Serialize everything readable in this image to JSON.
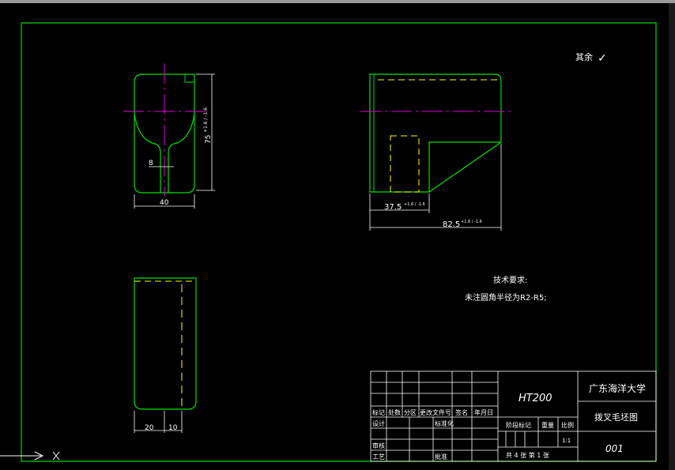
{
  "roughness": {
    "label": "其余",
    "symbol": "✓"
  },
  "front_view": {
    "dim_width": "40",
    "dim_slot": "8",
    "dim_height": "75",
    "dim_height_tol": "+1.6 / -1.6"
  },
  "side_view": {
    "dim_inner": "37.5",
    "dim_inner_tol": "+1.6 / -1.6",
    "dim_overall": "82.5",
    "dim_overall_tol": "+1.6 / -1.6"
  },
  "top_view": {
    "dim_a": "20",
    "dim_b": "10"
  },
  "notes": {
    "title": "技术要求:",
    "line1": "未注圆角半径为R2-R5;"
  },
  "title_block": {
    "material": "HT200",
    "university": "广东海洋大学",
    "drawing_name": "拨叉毛坯图",
    "drawing_no": "001",
    "hdr_mark": "标记",
    "hdr_count": "处数",
    "hdr_zone": "分区",
    "hdr_change_doc": "更改文件号",
    "hdr_sign": "签名",
    "hdr_date": "年月日",
    "design": "设计",
    "standardize": "标准化",
    "review": "审核",
    "process": "工艺",
    "approve": "批准",
    "stage_mark": "阶段标记",
    "weight": "重量",
    "scale": "比例",
    "scale_value": "1:1",
    "sheets": "共 4 张  第 1 张"
  },
  "colors": {
    "border": "#00e000",
    "center": "#e000e0",
    "hidden": "#ffff00",
    "dim": "#ffffff",
    "background": "#000000"
  }
}
